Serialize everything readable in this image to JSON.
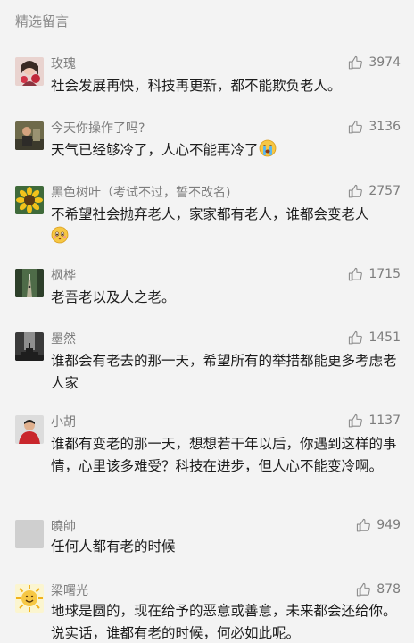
{
  "section_title": "精选留言",
  "comments": [
    {
      "name": "玫瑰",
      "likes": "3974",
      "text": "社会发展再快，科技再更新，都不能欺负老人。",
      "avatar_icon": "rose-portrait-avatar"
    },
    {
      "name": "今天你操作了吗?",
      "likes": "3136",
      "text": "天气已经够冷了，人心不能再冷了",
      "avatar_icon": "person-photo-avatar",
      "emoji": "crying-face-emoji"
    },
    {
      "name": "黑色树叶（考试不过，誓不改名)",
      "likes": "2757",
      "text": "不希望社会抛弃老人，家家都有老人，谁都会变老人",
      "avatar_icon": "sunflower-avatar",
      "emoji": "worried-face-emoji"
    },
    {
      "name": "枫桦",
      "likes": "1715",
      "text": "老吾老以及人之老。",
      "avatar_icon": "forest-path-avatar"
    },
    {
      "name": "墨然",
      "likes": "1451",
      "text": "谁都会有老去的那一天，希望所有的举措都能更多考虑老人家",
      "avatar_icon": "dark-stairs-avatar"
    },
    {
      "name": "小胡",
      "likes": "1137",
      "text": "谁都有变老的那一天，想想若干年以后，你遇到这样的事情，心里该多难受？科技在进步，但人心不能变冷啊。",
      "avatar_icon": "red-jacket-person-avatar"
    },
    {
      "name": "曉帥",
      "likes": "949",
      "text": "任何人都有老的时候",
      "avatar_icon": "default-gray-avatar"
    },
    {
      "name": "梁曙光",
      "likes": "878",
      "text": "地球是圆的，现在给予的恶意或善意，未来都会还给你。说实话，谁都有老的时候，何必如此呢。",
      "avatar_icon": "sun-smile-avatar"
    }
  ],
  "colors": {
    "background": "#f3f3f3",
    "name": "#7d7d7d",
    "text": "#1c1c1c",
    "title": "#8a8a8a"
  }
}
